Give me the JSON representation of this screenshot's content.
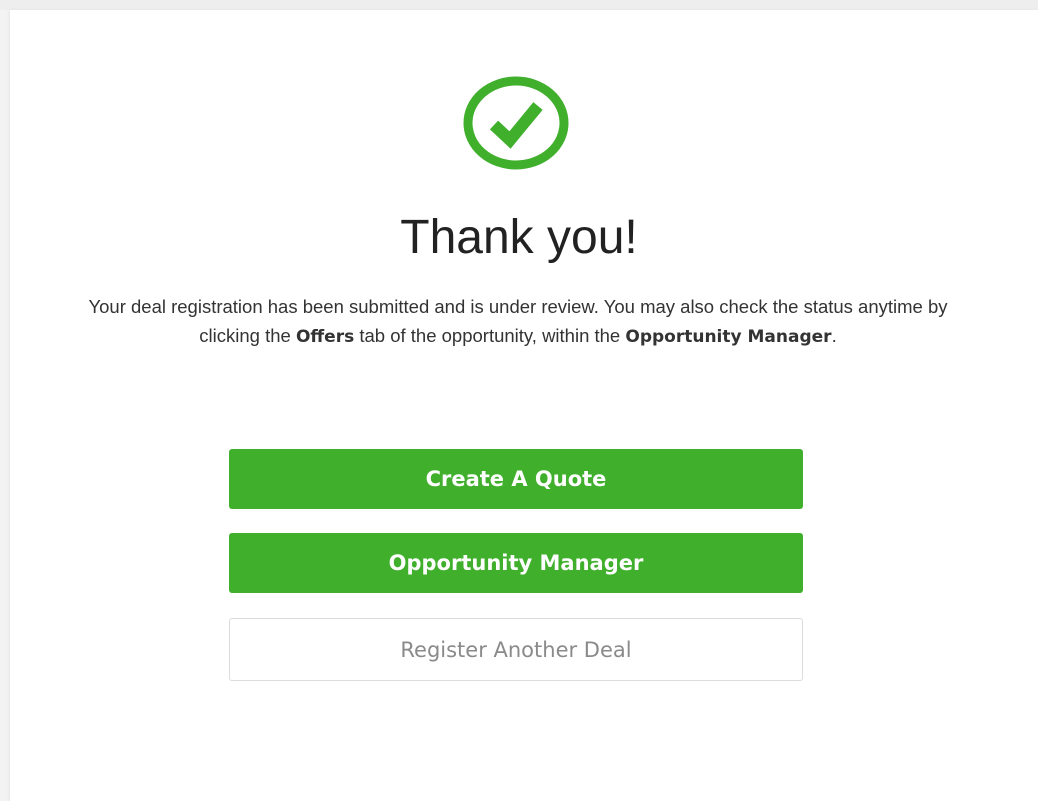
{
  "colors": {
    "accent": "#3faf2c",
    "success_icon": "#3faf2c",
    "secondary_text": "#8a8a8a"
  },
  "confirmation": {
    "icon": "check-circle-icon",
    "title": "Thank you!",
    "message": {
      "part1": "Your deal registration has been submitted and is under review. You may also check the status anytime by clicking the ",
      "offers_label": "Offers",
      "part2": " tab of the opportunity, within the ",
      "manager_label": "Opportunity Manager",
      "part3": "."
    }
  },
  "actions": {
    "create_quote_label": "Create A Quote",
    "opportunity_manager_label": "Opportunity Manager",
    "register_another_label": "Register Another Deal"
  }
}
